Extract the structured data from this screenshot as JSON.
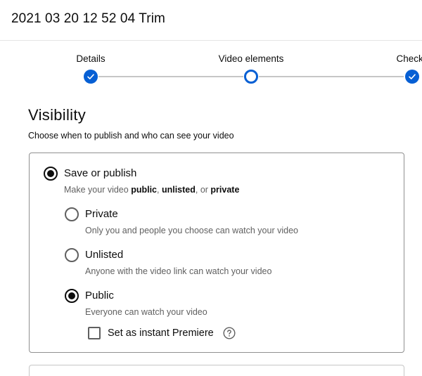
{
  "header": {
    "title": "2021 03 20 12 52 04 Trim"
  },
  "stepper": {
    "steps": [
      {
        "label": "Details",
        "state": "completed"
      },
      {
        "label": "Video elements",
        "state": "current"
      },
      {
        "label": "Checks",
        "state": "completed"
      }
    ]
  },
  "visibility": {
    "title": "Visibility",
    "subtitle": "Choose when to publish and who can see your video",
    "save_or_publish": {
      "label": "Save or publish",
      "desc_prefix": "Make your video ",
      "desc_public": "public",
      "desc_sep1": ", ",
      "desc_unlisted": "unlisted",
      "desc_sep2": ", or ",
      "desc_private": "private",
      "selected": true
    },
    "options": [
      {
        "label": "Private",
        "desc": "Only you and people you choose can watch your video",
        "selected": false
      },
      {
        "label": "Unlisted",
        "desc": "Anyone with the video link can watch your video",
        "selected": false
      },
      {
        "label": "Public",
        "desc": "Everyone can watch your video",
        "selected": true
      }
    ],
    "premiere": {
      "label": "Set as instant Premiere",
      "checked": false
    }
  },
  "colors": {
    "accent": "#065fd4",
    "text": "#0d0d0d",
    "secondary_text": "#606060",
    "border": "#909090"
  },
  "icons": {
    "step_done": "check-icon",
    "help": "help-circle-icon"
  }
}
